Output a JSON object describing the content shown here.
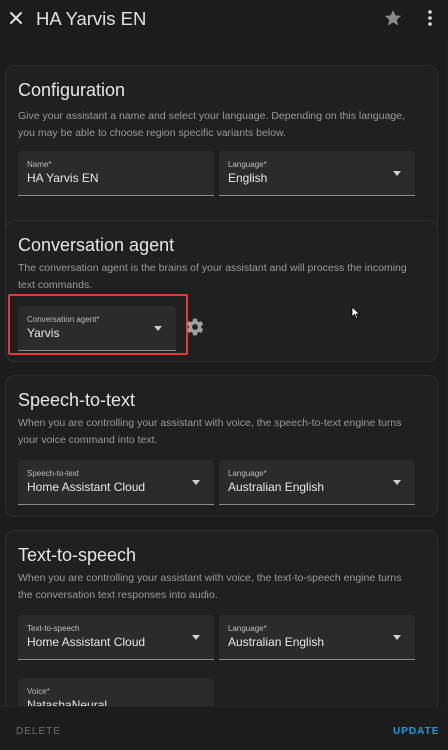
{
  "header": {
    "title": "HA Yarvis EN"
  },
  "configuration": {
    "title": "Configuration",
    "description": "Give your assistant a name and select your language. Depending on this language, you may be able to choose region specific variants below.",
    "name_label": "Name*",
    "name_value": "HA Yarvis EN",
    "language_label": "Language*",
    "language_value": "English"
  },
  "conversation": {
    "title": "Conversation agent",
    "description": "The conversation agent is the brains of your assistant and will process the incoming text commands.",
    "agent_label": "Conversation agent*",
    "agent_value": "Yarvis"
  },
  "stt": {
    "title": "Speech-to-text",
    "description": "When you are controlling your assistant with voice, the speech-to-text engine turns your voice command into text.",
    "engine_label": "Speech-to-text",
    "engine_value": "Home Assistant Cloud",
    "language_label": "Language*",
    "language_value": "Australian English"
  },
  "tts": {
    "title": "Text-to-speech",
    "description": "When you are controlling your assistant with voice, the text-to-speech engine turns the conversation text responses into audio.",
    "engine_label": "Text-to-speech",
    "engine_value": "Home Assistant Cloud",
    "language_label": "Language*",
    "language_value": "Australian English",
    "voice_label": "Voice*",
    "voice_value": "NatashaNeural"
  },
  "footer": {
    "delete_label": "DELETE",
    "update_label": "UPDATE"
  },
  "colors": {
    "accent": "#1e9ad6",
    "highlight": "#e23b3b",
    "background": "#1c1c1c",
    "card": "#202020"
  },
  "icons": [
    "close-icon",
    "star-icon",
    "chevron-down-icon",
    "gear-icon",
    "mouse-cursor-icon"
  ]
}
